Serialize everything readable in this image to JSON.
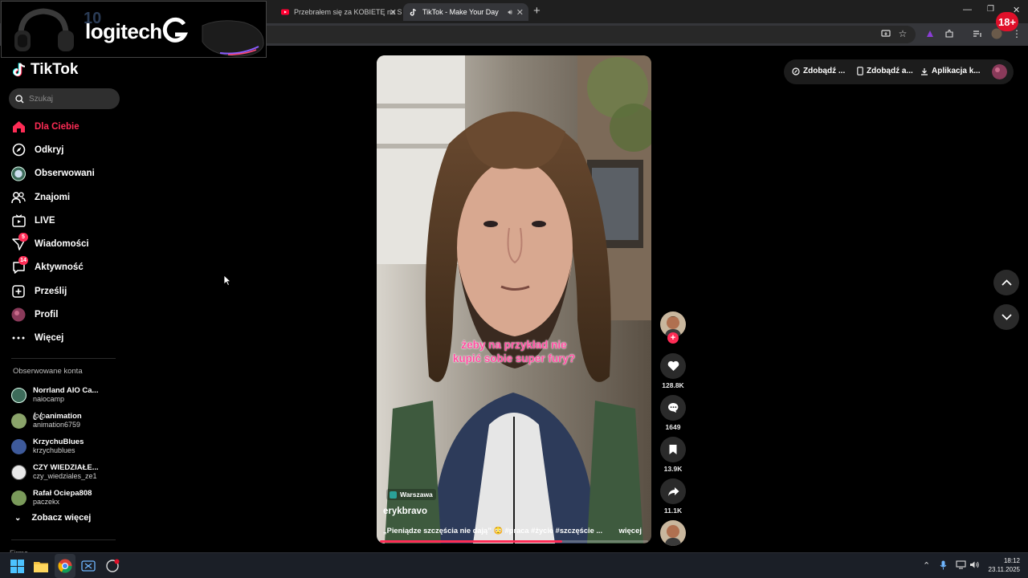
{
  "browser": {
    "tabs": [
      {
        "title": "Przebrałem się za KOBIETĘ na S",
        "favicon": "youtube-icon",
        "active": false
      },
      {
        "title": "TikTok - Make Your Day",
        "favicon": "tiktok-icon",
        "active": true
      }
    ],
    "new_tab_label": "+"
  },
  "ad": {
    "brand": "logitech",
    "number_text": "10",
    "age_badge": "18+"
  },
  "tiktok": {
    "logo_text": "TikTok",
    "search": {
      "placeholder": "Szukaj"
    },
    "nav": [
      {
        "label": "Dla Ciebie",
        "icon": "home-icon",
        "active": true
      },
      {
        "label": "Odkryj",
        "icon": "compass-icon"
      },
      {
        "label": "Obserwowani",
        "icon": "following-avatar-icon"
      },
      {
        "label": "Znajomi",
        "icon": "friends-icon"
      },
      {
        "label": "LIVE",
        "icon": "live-icon"
      },
      {
        "label": "Wiadomości",
        "icon": "messages-icon",
        "badge": "5"
      },
      {
        "label": "Aktywność",
        "icon": "activity-icon",
        "badge": "14"
      },
      {
        "label": "Prześlij",
        "icon": "upload-icon"
      },
      {
        "label": "Profil",
        "icon": "profile-avatar-icon"
      },
      {
        "label": "Więcej",
        "icon": "more-dots-icon"
      }
    ],
    "followed_title": "Obserwowane konta",
    "followed_accounts": [
      {
        "name": "Norrland AIO Ca...",
        "handle": "naiocamp",
        "color": "#4a7a6a"
      },
      {
        "name": "ꦿꦿanimation",
        "handle": "animation6759",
        "color": "#8aa36a"
      },
      {
        "name": "KrzychuBlues",
        "handle": "krzychublues",
        "color": "#3e5a9a"
      },
      {
        "name": "CZY WIEDZIAŁE...",
        "handle": "czy_wiedziales_ze1",
        "color": "#d8d8d8"
      },
      {
        "name": "Rafał Ociepa808",
        "handle": "paczekx",
        "color": "#7a9a5a"
      }
    ],
    "see_more": "Zobacz więcej",
    "cutoff_text": "Firma",
    "top_actions": [
      {
        "label": "Zdobądź ...",
        "icon": "coin-icon"
      },
      {
        "label": "Zdobądź a...",
        "icon": "phone-icon"
      },
      {
        "label": "Aplikacja k...",
        "icon": "download-icon"
      }
    ],
    "video": {
      "subtitle_line1": "żeby na przykład nie",
      "subtitle_line2": "kupić sobie super fury?",
      "location": "Warszawa",
      "author": "erykbravo",
      "caption": "„Pieniądze szczęścia nie dają” 😳 #praca #życie #szczęście ...",
      "more": "więcej",
      "progress": 0.68
    },
    "actions": {
      "likes": "128.8K",
      "comments": "1649",
      "saves": "13.9K",
      "shares": "11.1K"
    }
  },
  "taskbar": {
    "time": "18:12",
    "date": "23.11.2025"
  },
  "colors": {
    "accent": "#fe2c55",
    "background": "#000000",
    "chrome_dark": "#1f1f1f"
  }
}
